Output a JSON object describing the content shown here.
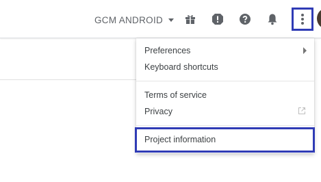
{
  "header": {
    "project_name": "GCM ANDROID",
    "icons": [
      "gift-icon",
      "feedback-icon",
      "help-icon",
      "notifications-icon",
      "more-vert-icon"
    ]
  },
  "menu": {
    "items": [
      {
        "label": "Preferences",
        "has_submenu": true
      },
      {
        "label": "Keyboard shortcuts"
      },
      {
        "label": "Terms of service"
      },
      {
        "label": "Privacy",
        "external_link": true
      },
      {
        "label": "Project information",
        "highlighted": true
      }
    ]
  },
  "colors": {
    "highlight_border": "#2f3bb5",
    "icon_gray": "#5f6368"
  }
}
